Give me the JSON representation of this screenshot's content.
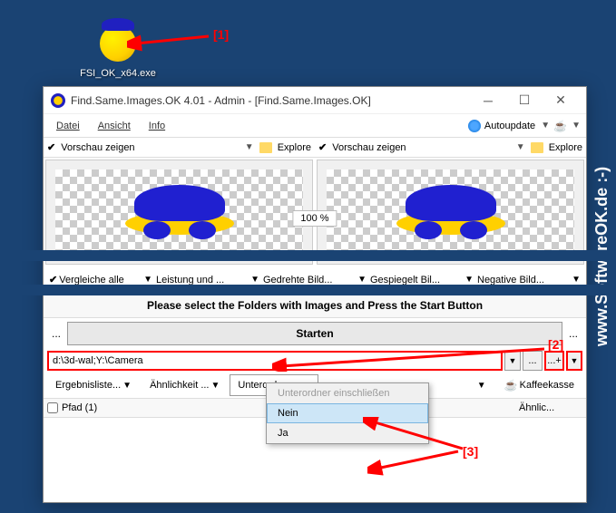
{
  "desktop": {
    "icon_label": "FSI_OK_x64.exe"
  },
  "annotations": {
    "a1": "[1]",
    "a2": "[2]",
    "a3": "[3]"
  },
  "watermark": "www.SoftwareOK.de :-)",
  "window": {
    "title": "Find.Same.Images.OK 4.01 - Admin - [Find.Same.Images.OK]",
    "menu": {
      "datei": "Datei",
      "ansicht": "Ansicht",
      "info": "Info",
      "autoupdate": "Autoupdate"
    },
    "preview": {
      "show_left": "Vorschau zeigen",
      "show_right": "Vorschau zeigen",
      "explore_left": "Explore",
      "explore_right": "Explore",
      "zoom": "100 %"
    },
    "options": {
      "compare": "Vergleiche alle",
      "performance": "Leistung und ...",
      "rotated": "Gedrehte Bild...",
      "mirrored": "Gespiegelt Bil...",
      "negative": "Negative Bild..."
    },
    "instruction": "Please select the Folders with Images and Press the Start Button",
    "start": "Starten",
    "path_value": "d:\\3d-wal;Y:\\Camera",
    "filters": {
      "results": "Ergebnisliste...",
      "similarity": "Ähnlichkeit ...",
      "subfolders": "Unterordner...",
      "coffee": "Kaffeekasse"
    },
    "list": {
      "path_header": "Pfad (1)",
      "similarity_header": "Ähnlic..."
    },
    "dropdown": {
      "include": "Unterordner einschließen",
      "no": "Nein",
      "yes": "Ja"
    }
  }
}
